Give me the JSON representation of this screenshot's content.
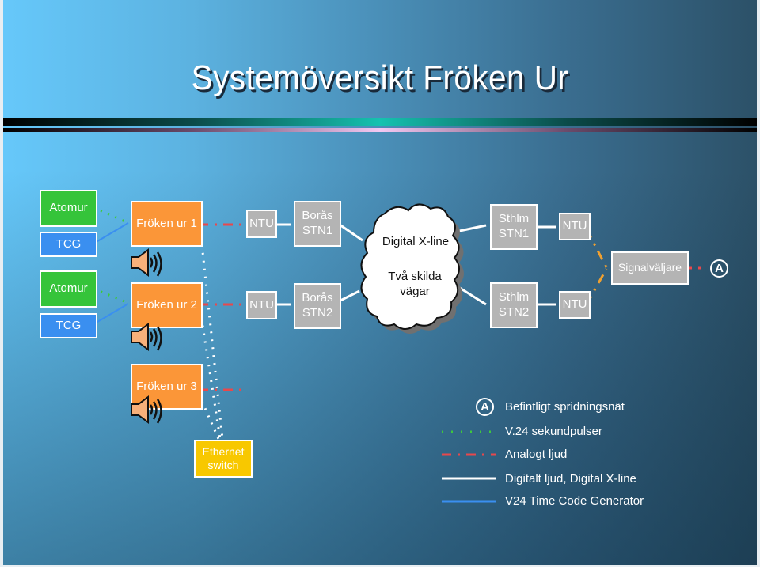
{
  "title": "Systemöversikt  Fröken Ur",
  "sources": [
    {
      "atomur": "Atomur",
      "tcg": "TCG"
    },
    {
      "atomur": "Atomur",
      "tcg": "TCG"
    }
  ],
  "clocks": [
    "Fröken ur 1",
    "Fröken ur 2",
    "Fröken ur 3"
  ],
  "boras": {
    "ntu1": "NTU",
    "ntu2": "NTU",
    "stn1": "Borås STN1",
    "stn2": "Borås STN2"
  },
  "cloud": {
    "line1": "Digital X-line",
    "line2": "Två skilda vägar"
  },
  "sthlm": {
    "stn1": "Sthlm STN1",
    "stn2": "Sthlm STN2",
    "ntu1": "NTU",
    "ntu2": "NTU"
  },
  "selector": "Signalväljare",
  "network_marker": "A",
  "ethernet_switch": "Ethernet switch",
  "legend": [
    {
      "symbol": "circle-A",
      "label": "Befintligt spridningsnät"
    },
    {
      "symbol": "green-dotted",
      "label": "V.24 sekundpulser",
      "color": "#3ec83e"
    },
    {
      "symbol": "red-dash-dot",
      "label": "Analogt ljud",
      "color": "#e8484c"
    },
    {
      "symbol": "white-solid",
      "label": "Digitalt ljud, Digital X-line",
      "color": "#ffffff"
    },
    {
      "symbol": "blue-solid",
      "label": "V24 Time Code Generator",
      "color": "#3a8ff0"
    }
  ],
  "colors": {
    "atomur": "#35c43a",
    "tcg": "#3a8ff0",
    "clock": "#fb9638",
    "station": "#b4b4b4",
    "switch": "#f8c800",
    "ntu_link_sthlm": "#f0a030"
  }
}
